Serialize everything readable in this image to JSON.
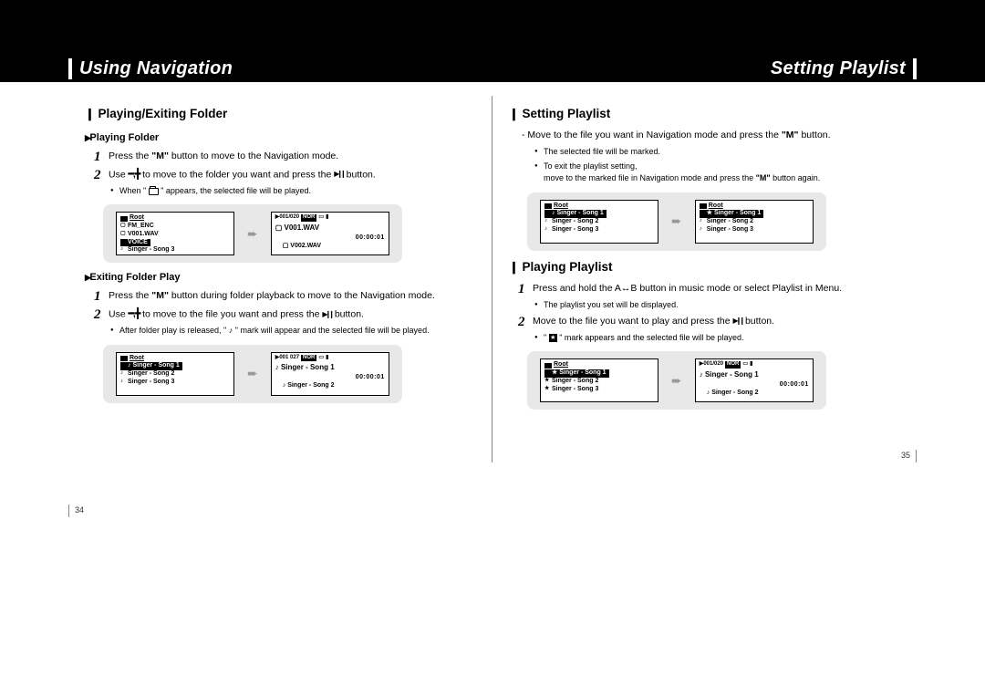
{
  "header": {
    "left": "Using Navigation",
    "right": "Setting Playlist"
  },
  "left_page": {
    "section": "Playing/Exiting Folder",
    "sub1": "Playing Folder",
    "step1_1": {
      "num": "1",
      "text_a": "Press the ",
      "bold": "\"M\"",
      "text_b": " button to move to the Navigation mode."
    },
    "step1_2": {
      "num": "2",
      "text_a": "Use ",
      "icon": "━,╋",
      "text_b": " to move to the folder you want and press the ",
      "icon2": "▶❙❙",
      "text_c": " button."
    },
    "bullet1_2": {
      "a": "When \" ",
      "b": " \" appears, the selected file will be played."
    },
    "screen1": {
      "panel_a": {
        "root": "Root",
        "rows": [
          "FM_ENC",
          "V001.WAV"
        ],
        "hl": "VOICE",
        "last": "Singer - Song 3"
      },
      "panel_b": {
        "top": "▶001/020",
        "badges": [
          "NOR",
          "",
          "🔋"
        ],
        "title": "V001.WAV",
        "time": "00:00:01",
        "sub": "V002.WAV"
      }
    },
    "sub2": "Exiting Folder Play",
    "step2_1": {
      "num": "1",
      "text_a": "Press the ",
      "bold": "\"M\"",
      "text_b": " button during folder playback to move to the Navigation mode."
    },
    "step2_2": {
      "num": "2",
      "text_a": "Use ",
      "icon": "━,╋",
      "text_b": " to move to the file you want and press the ",
      "icon2": "▶❙❙",
      "text_c": " button."
    },
    "bullet2_2": {
      "a": "After folder play is released, \" ",
      "note": "♪",
      "b": " \" mark will appear and the selected file will be played."
    },
    "screen2": {
      "panel_a": {
        "root": "Root",
        "hl": "Singer - Song 1",
        "rows": [
          "Singer - Song 2",
          "Singer - Song 3"
        ]
      },
      "panel_b": {
        "top": "▶001 027",
        "badges": [
          "NOR",
          "",
          "🔋"
        ],
        "title": "Singer - Song 1",
        "time": "00:00:01",
        "sub": "Singer - Song 2"
      }
    },
    "pagenum": "34"
  },
  "right_page": {
    "section1": "Setting Playlist",
    "dash": {
      "a": "- Move to the file you want in Navigation mode and press the ",
      "bold": "\"M\"",
      "b": " button."
    },
    "bullet_a": "The selected file will be marked.",
    "bullet_b_a": "To exit the playlist setting,",
    "bullet_b_line2": {
      "a": "move to the marked file in Navigation mode and press the ",
      "bold": "\"M\"",
      "b": " button again."
    },
    "screen3": {
      "panel_a": {
        "root": "Root",
        "hl": "Singer - Song 1",
        "rows": [
          "Singer - Song 2",
          "Singer - Song 3"
        ]
      },
      "panel_b": {
        "root": "Root",
        "star_hl": "Singer - Song 1",
        "rows": [
          "Singer - Song 2",
          "Singer - Song 3"
        ]
      }
    },
    "section2": "Playing Playlist",
    "step3_1": {
      "num": "1",
      "text_a": "Press and hold the A↔B button in music mode or select Playlist in Menu."
    },
    "bullet3_1": "The playlist you set will be displayed.",
    "step3_2": {
      "num": "2",
      "text_a": "Move to the file you want to play and press the ",
      "icon": "▶❙❙",
      "text_b": " button."
    },
    "bullet3_2": {
      "a": "\" ",
      "b": " \" mark appears and the selected file will be played."
    },
    "screen4": {
      "panel_a": {
        "root": "Root",
        "star_hl": "Singer - Song 1",
        "star_rows": [
          "Singer - Song 2",
          "Singer - Song 3"
        ]
      },
      "panel_b": {
        "top": "▶001/020",
        "badges": [
          "NOR",
          "",
          "🔋"
        ],
        "title": "Singer - Song 1",
        "time": "00:00:01",
        "sub": "Singer - Song 2"
      }
    },
    "pagenum": "35"
  }
}
